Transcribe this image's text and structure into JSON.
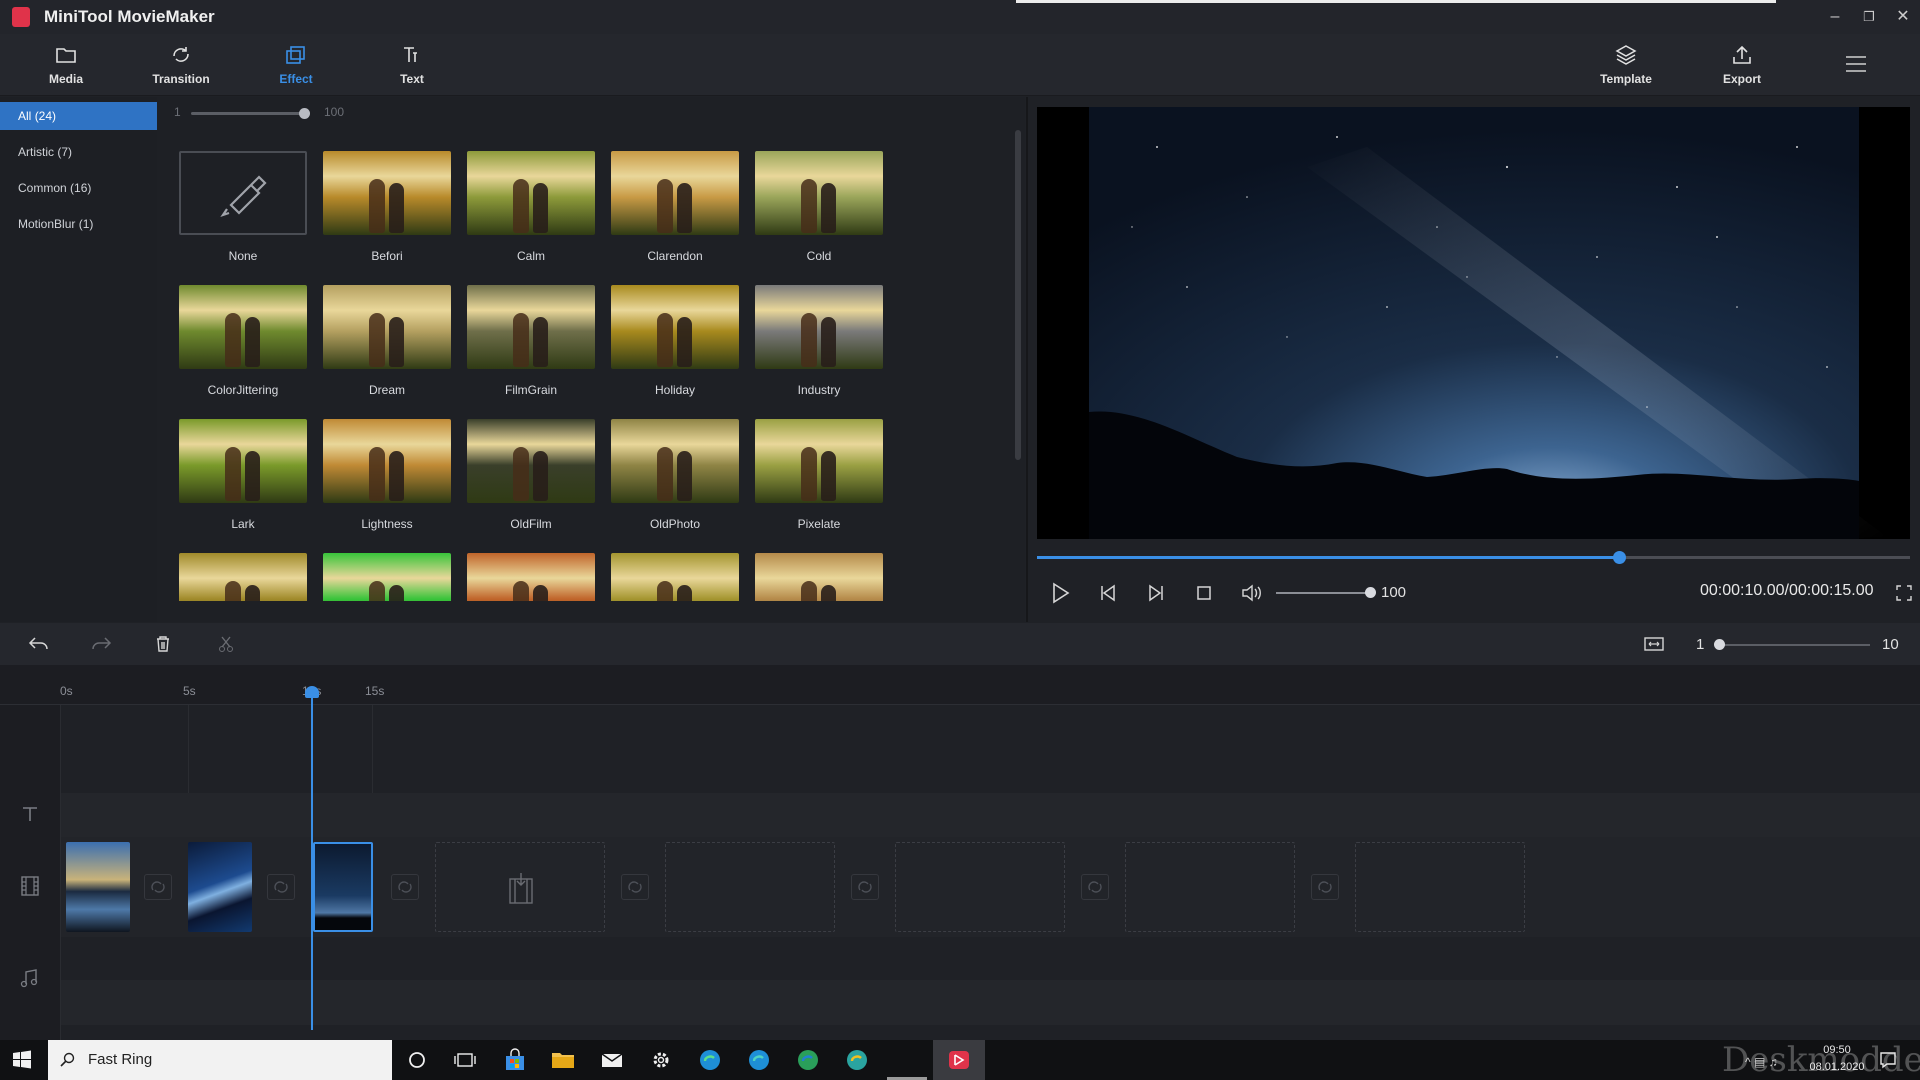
{
  "app": {
    "title": "MiniTool MovieMaker"
  },
  "toolbar": {
    "items": [
      {
        "label": "Media",
        "icon": "folder-icon"
      },
      {
        "label": "Transition",
        "icon": "transition-icon"
      },
      {
        "label": "Effect",
        "icon": "effect-icon",
        "active": true
      },
      {
        "label": "Text",
        "icon": "text-icon"
      }
    ],
    "right_items": [
      {
        "label": "Template",
        "icon": "layers-icon"
      },
      {
        "label": "Export",
        "icon": "export-icon"
      }
    ],
    "accent_color": "#3a8fe6"
  },
  "categories": [
    {
      "label": "All",
      "count": "(24)",
      "active": true
    },
    {
      "label": "Artistic",
      "count": "(7)"
    },
    {
      "label": "Common",
      "count": "(16)"
    },
    {
      "label": "MotionBlur",
      "count": "(1)"
    }
  ],
  "intensity": {
    "min": "1",
    "max": "100",
    "value_fraction": 1.0
  },
  "effects": [
    {
      "name": "None",
      "tint": "none"
    },
    {
      "name": "Befori",
      "tint": "#b88a2a"
    },
    {
      "name": "Calm",
      "tint": "#8d9a3a"
    },
    {
      "name": "Clarendon",
      "tint": "#c89a45"
    },
    {
      "name": "Cold",
      "tint": "#9aa55a"
    },
    {
      "name": "ColorJittering",
      "tint": "#6f8a2e"
    },
    {
      "name": "Dream",
      "tint": "#b4a060"
    },
    {
      "name": "FilmGrain",
      "tint": "#6f6f4a"
    },
    {
      "name": "Holiday",
      "tint": "#a88a1e"
    },
    {
      "name": "Industry",
      "tint": "#7a7a7a"
    },
    {
      "name": "Lark",
      "tint": "#7a9a2a"
    },
    {
      "name": "Lightness",
      "tint": "#c08a35"
    },
    {
      "name": "OldFilm",
      "tint": "#3a3f2a"
    },
    {
      "name": "OldPhoto",
      "tint": "#8f8445"
    },
    {
      "name": "Pixelate",
      "tint": "#9aa043"
    },
    {
      "name": "",
      "tint": "#a08a2a"
    },
    {
      "name": "",
      "tint": "#38c43a"
    },
    {
      "name": "",
      "tint": "#c0642a"
    },
    {
      "name": "",
      "tint": "#a4952f"
    },
    {
      "name": "",
      "tint": "#b58a4a"
    }
  ],
  "player": {
    "volume": "100",
    "time": "00:00:10.00/00:00:15.00",
    "progress_fraction": 0.667,
    "volume_fraction": 1.0
  },
  "timeline": {
    "zoom_min": "1",
    "zoom_max": "10",
    "ticks": [
      "0s",
      "5s",
      "10s",
      "15s"
    ],
    "playhead_seconds": 10
  },
  "taskbar": {
    "search_text": "Fast Ring",
    "clock_time": "09:50",
    "clock_date": "08.01.2020",
    "watermark": "Deskmodder.de"
  }
}
